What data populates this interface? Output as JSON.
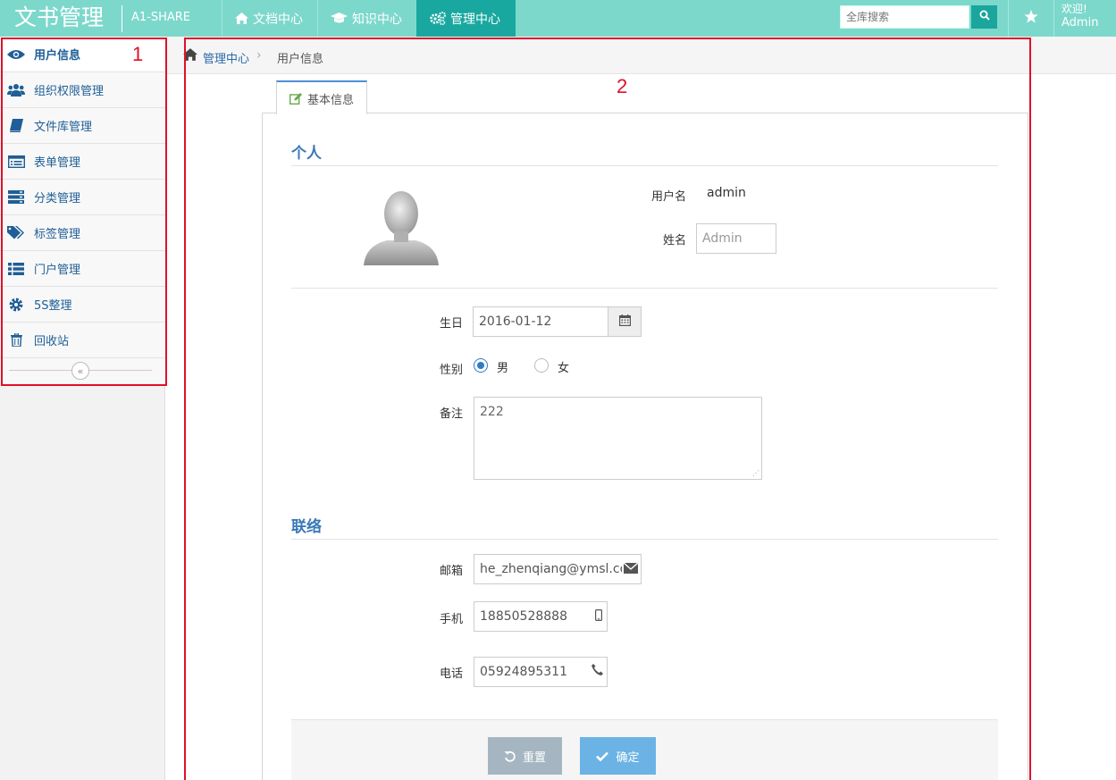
{
  "app": {
    "title": "文书管理",
    "subtitle": "A1-SHARE"
  },
  "nav": {
    "items": [
      {
        "label": "文档中心",
        "icon": "home-icon"
      },
      {
        "label": "知识中心",
        "icon": "graduation-cap-icon"
      },
      {
        "label": "管理中心",
        "icon": "cogs-icon",
        "active": true
      }
    ]
  },
  "search": {
    "placeholder": "全库搜索"
  },
  "user": {
    "welcome": "欢迎!",
    "name": "Admin"
  },
  "sidebar": {
    "items": [
      {
        "label": "用户信息",
        "icon": "eye-icon",
        "active": true
      },
      {
        "label": "组织权限管理",
        "icon": "users-icon"
      },
      {
        "label": "文件库管理",
        "icon": "book-icon"
      },
      {
        "label": "表单管理",
        "icon": "list-alt-icon"
      },
      {
        "label": "分类管理",
        "icon": "server-icon"
      },
      {
        "label": "标签管理",
        "icon": "tags-icon"
      },
      {
        "label": "门户管理",
        "icon": "list-icon"
      },
      {
        "label": "5S整理",
        "icon": "cog-icon"
      },
      {
        "label": "回收站",
        "icon": "trash-icon"
      }
    ],
    "collapse_symbol": "«"
  },
  "annotations": {
    "box1": "1",
    "box2": "2"
  },
  "breadcrumb": {
    "items": [
      "管理中心",
      "用户信息"
    ],
    "separator": "›"
  },
  "tab": {
    "label": "基本信息"
  },
  "sections": {
    "personal": "个人",
    "contact": "联络"
  },
  "profile": {
    "username_label": "用户名",
    "username_value": "admin",
    "name_label": "姓名",
    "name_placeholder": "Admin",
    "birthday_label": "生日",
    "birthday_value": "2016-01-12",
    "gender_label": "性别",
    "gender_male": "男",
    "gender_female": "女",
    "gender_selected": "男",
    "remark_label": "备注",
    "remark_value": "222"
  },
  "contact": {
    "email_label": "邮箱",
    "email_value": "he_zhenqiang@ymsl.cc",
    "mobile_label": "手机",
    "mobile_value": "18850528888",
    "phone_label": "电话",
    "phone_value": "05924895311"
  },
  "buttons": {
    "reset": "重置",
    "confirm": "确定"
  },
  "colors": {
    "topbar": "#7dd8cc",
    "nav_active": "#19a8a0",
    "accent_blue": "#3b79b6",
    "annotation_red": "#e0102a",
    "reset_button": "#a5b6c2",
    "confirm_button": "#6bb3e4"
  }
}
